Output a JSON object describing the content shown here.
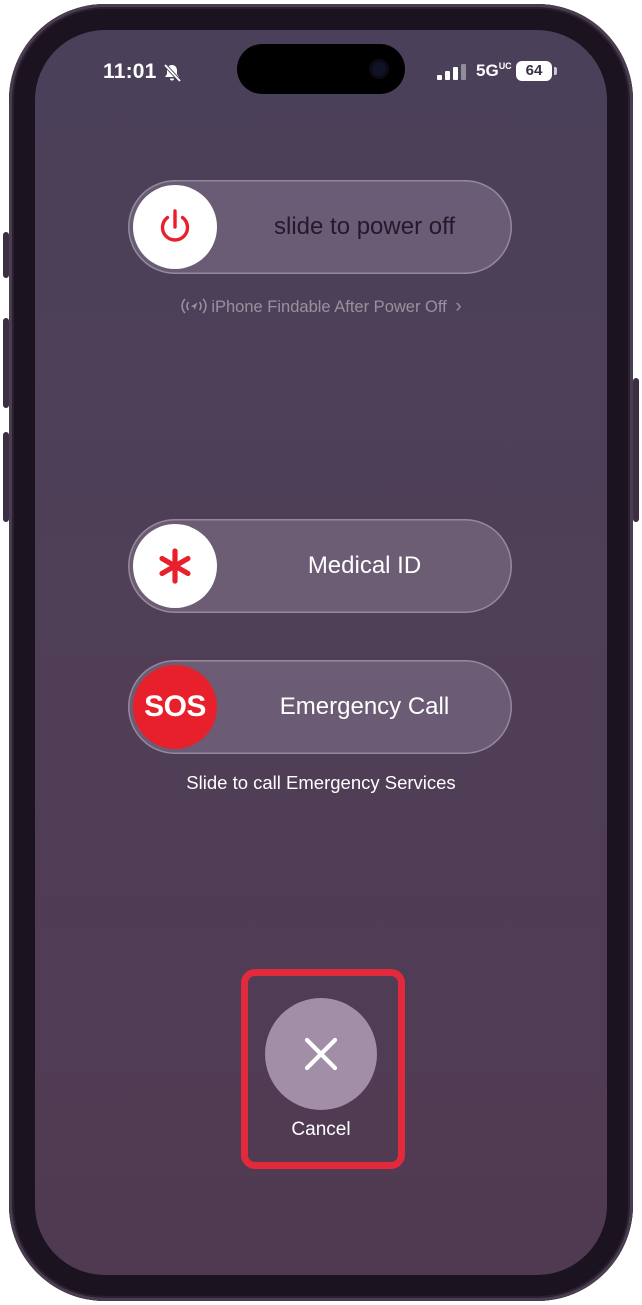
{
  "status_bar": {
    "time": "11:01",
    "network": "5G",
    "network_suffix": "UC",
    "battery": "64",
    "icons": [
      "bell-slash-icon",
      "cellular-signal-icon"
    ]
  },
  "power_slider": {
    "label": "slide to power off",
    "icon": "power-icon",
    "icon_color": "#e8202b"
  },
  "findable": {
    "text": "iPhone Findable After Power Off",
    "icon": "find-my-icon",
    "chevron": "›"
  },
  "medical_slider": {
    "label": "Medical ID",
    "icon": "asterisk-icon",
    "icon_color": "#e8202b"
  },
  "emergency_slider": {
    "label": "Emergency Call",
    "knob_text": "SOS",
    "knob_color": "#e8202b"
  },
  "emergency_caption": "Slide to call Emergency Services",
  "cancel": {
    "label": "Cancel",
    "icon": "close-icon",
    "highlight_color": "#e32a3c"
  }
}
